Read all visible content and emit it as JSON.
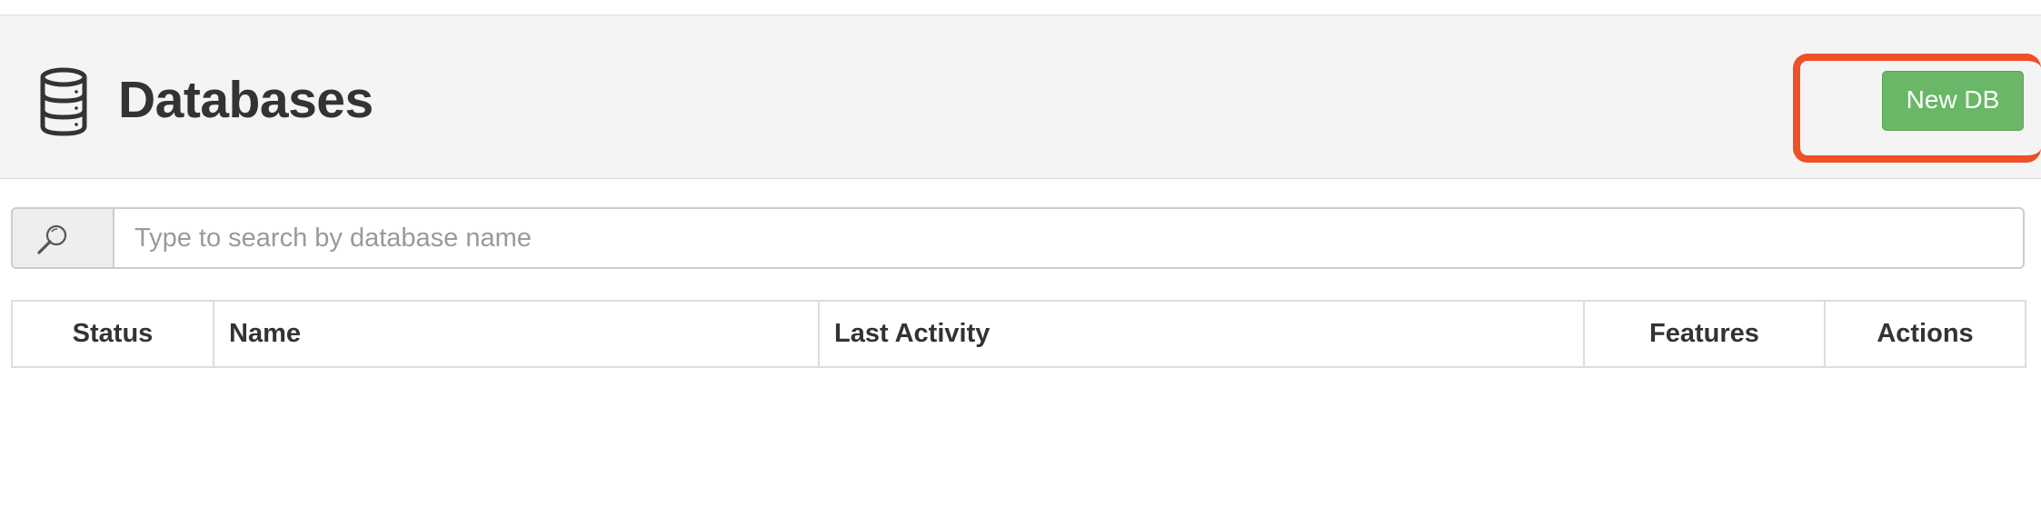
{
  "header": {
    "title": "Databases",
    "icon": "database-icon",
    "new_button_label": "New DB",
    "button_color": "#6ab867",
    "highlight_color": "#ee5028"
  },
  "search": {
    "icon": "search-icon",
    "placeholder": "Type to search by database name",
    "value": ""
  },
  "table": {
    "columns": [
      "Status",
      "Name",
      "Last Activity",
      "Features",
      "Actions"
    ],
    "rows": []
  }
}
